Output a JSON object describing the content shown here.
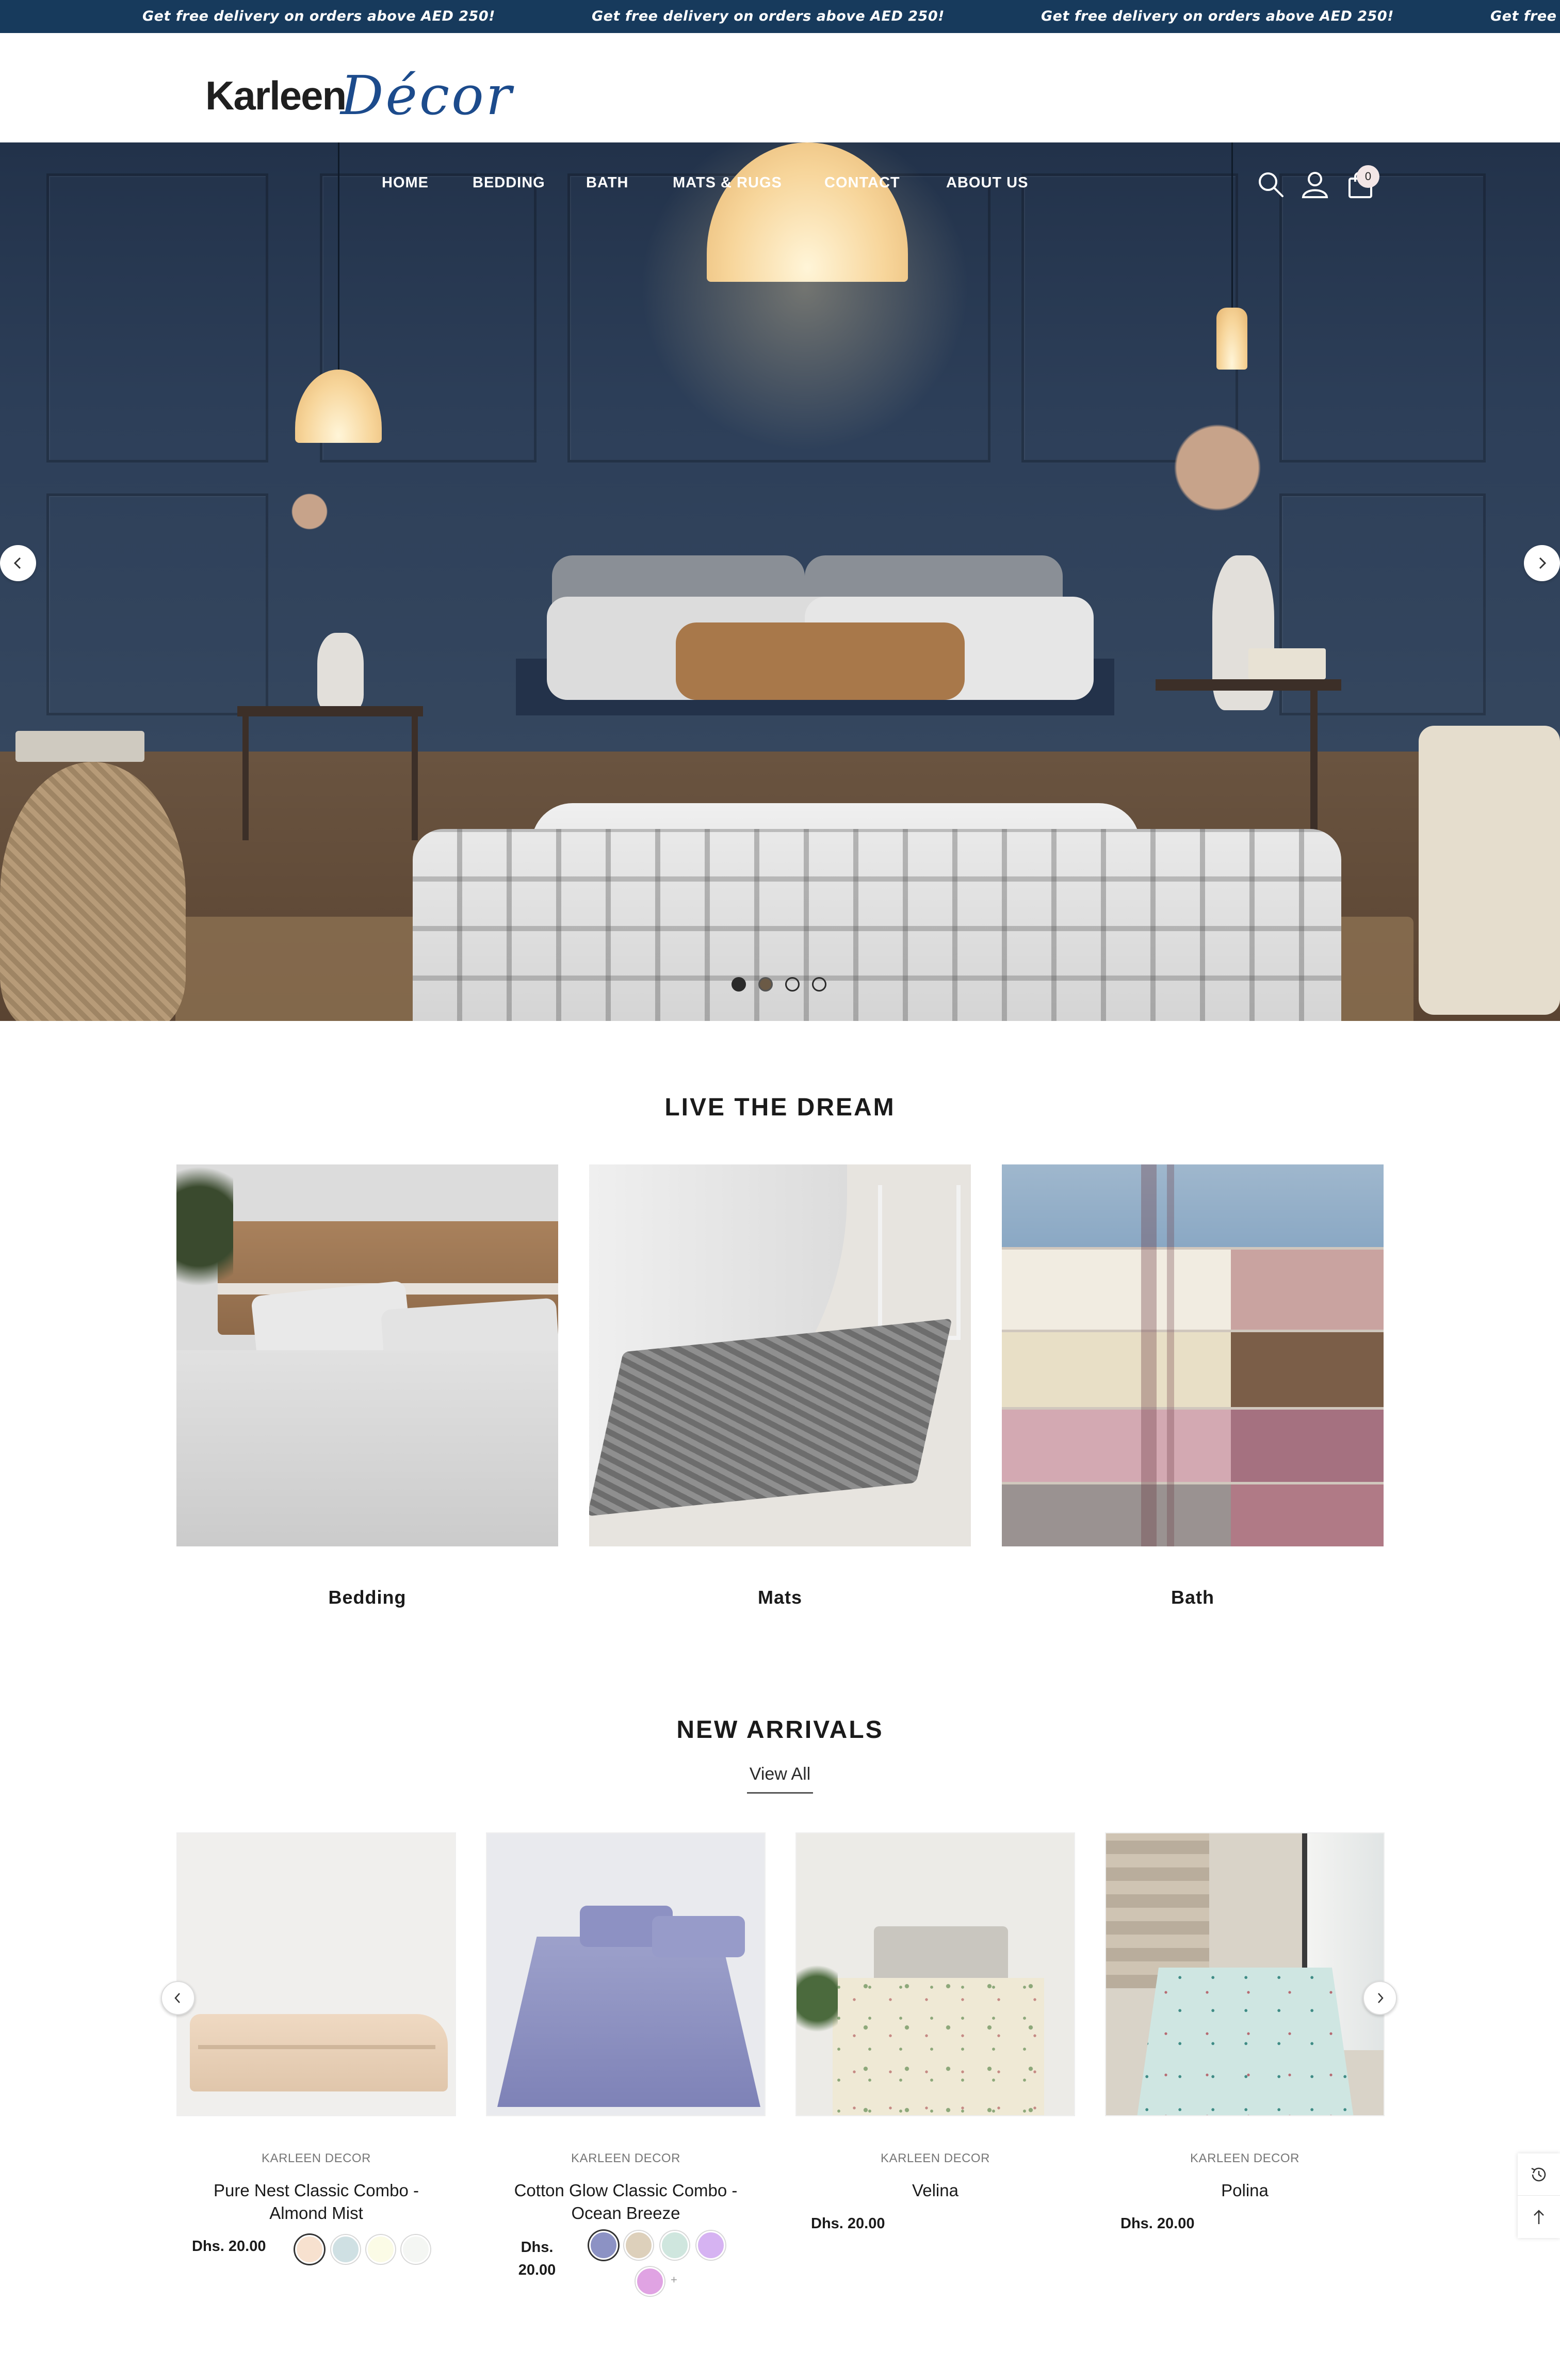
{
  "announcement": {
    "text": "Get free delivery on orders above AED 250!",
    "text_partial": "Get free d"
  },
  "brand": {
    "logo_word": "Karleen",
    "logo_script": "Décor",
    "colors": {
      "announcement_bg": "#173a5c",
      "logo_blue": "#1c4b8c",
      "text": "#1a1a1a"
    }
  },
  "nav": {
    "items": [
      "HOME",
      "BEDDING",
      "BATH",
      "MATS & RUGS",
      "CONTACT",
      "ABOUT US"
    ],
    "icons": [
      "search-icon",
      "account-icon",
      "cart-icon"
    ],
    "cart_count": "0"
  },
  "hero": {
    "slides_total": 4,
    "active_slide": 1,
    "prev_icon": "chevron-left-icon",
    "next_icon": "chevron-right-icon"
  },
  "categories": {
    "title": "LIVE THE DREAM",
    "items": [
      {
        "label": "Bedding"
      },
      {
        "label": "Mats"
      },
      {
        "label": "Bath"
      }
    ]
  },
  "new_arrivals": {
    "title": "NEW ARRIVALS",
    "view_all": "View All",
    "products": [
      {
        "vendor": "KARLEEN DECOR",
        "title": "Pure Nest Classic Combo - Almond Mist",
        "price": "Dhs. 20.00",
        "swatches": [
          "#f7e1cf",
          "#cfe0e3",
          "#fbfbe6",
          "#f4f6f3"
        ]
      },
      {
        "vendor": "KARLEEN DECOR",
        "title": "Cotton Glow Classic Combo - Ocean Breeze",
        "price_line1": "Dhs.",
        "price_line2": "20.00",
        "swatches": [
          "#8c92c4",
          "#ddd0bb",
          "#cfe6de",
          "#d6b3f2",
          "#e0a3e3"
        ],
        "more": "+"
      },
      {
        "vendor": "KARLEEN DECOR",
        "title": "Velina",
        "price": "Dhs. 20.00"
      },
      {
        "vendor": "KARLEEN DECOR",
        "title": "Polina",
        "price": "Dhs. 20.00"
      }
    ]
  },
  "side_tools": [
    "recently-viewed-icon",
    "back-to-top-icon"
  ]
}
